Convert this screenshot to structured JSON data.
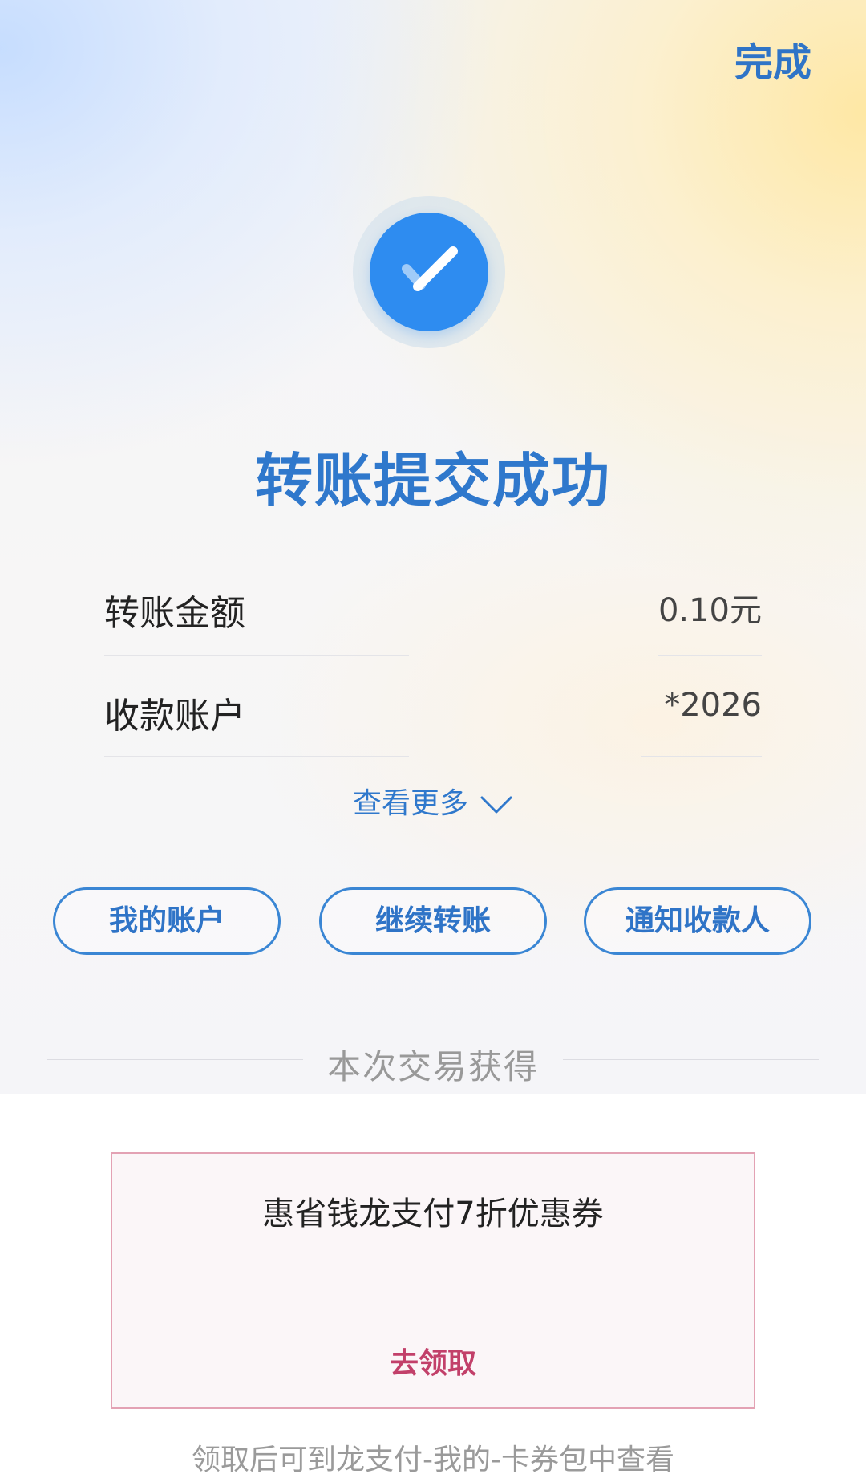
{
  "header": {
    "done_label": "完成"
  },
  "status": {
    "icon": "check-circle-icon",
    "title": "转账提交成功"
  },
  "details": {
    "rows": [
      {
        "label": "转账金额",
        "value": "0.10元"
      },
      {
        "label": "收款账户",
        "value": "*2026"
      }
    ],
    "more_label": "查看更多"
  },
  "actions": {
    "my_account": "我的账户",
    "continue_transfer": "继续转账",
    "notify_payee": "通知收款人"
  },
  "rewards": {
    "section_title": "本次交易获得",
    "coupon_title": "惠省钱龙支付7折优惠券",
    "claim_label": "去领取",
    "footnote": "领取后可到龙支付-我的-卡券包中查看"
  },
  "colors": {
    "accent_blue": "#2f78cc",
    "check_blue": "#2e8cf0",
    "claim_red": "#c2406a"
  }
}
